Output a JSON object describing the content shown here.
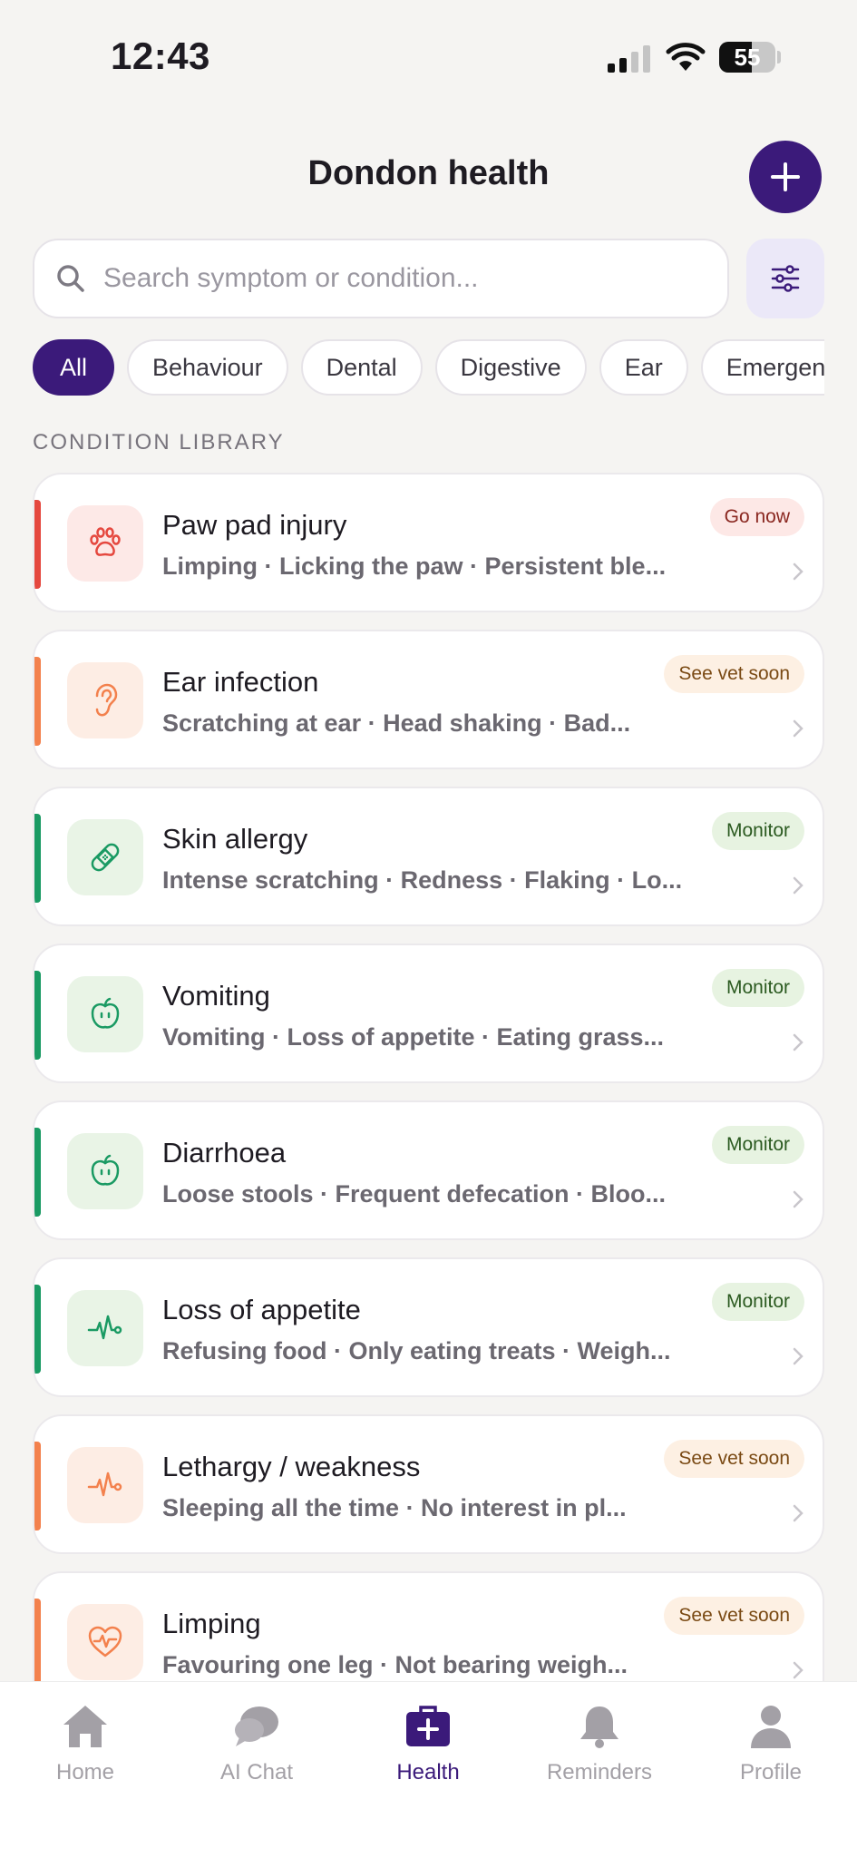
{
  "status_bar": {
    "time": "12:43",
    "battery": "55"
  },
  "header": {
    "title": "Dondon health"
  },
  "search": {
    "placeholder": "Search symptom or condition..."
  },
  "chips": [
    "All",
    "Behaviour",
    "Dental",
    "Digestive",
    "Ear",
    "Emergen"
  ],
  "section_label": "CONDITION LIBRARY",
  "conditions": [
    {
      "title": "Paw pad injury",
      "symptoms": "Limping · Licking the paw · Persistent ble...",
      "badge": "Go now",
      "urgency": "red",
      "icon": "paw-icon"
    },
    {
      "title": "Ear infection",
      "symptoms": "Scratching at ear · Head shaking · Bad...",
      "badge": "See vet soon",
      "urgency": "orange",
      "icon": "ear-icon"
    },
    {
      "title": "Skin allergy",
      "symptoms": "Intense scratching · Redness · Flaking · Lo...",
      "badge": "Monitor",
      "urgency": "green",
      "icon": "bandage-icon"
    },
    {
      "title": "Vomiting",
      "symptoms": "Vomiting · Loss of appetite · Eating grass...",
      "badge": "Monitor",
      "urgency": "green",
      "icon": "apple-icon"
    },
    {
      "title": "Diarrhoea",
      "symptoms": "Loose stools · Frequent defecation · Bloo...",
      "badge": "Monitor",
      "urgency": "green",
      "icon": "apple-icon"
    },
    {
      "title": "Loss of appetite",
      "symptoms": "Refusing food · Only eating treats · Weigh...",
      "badge": "Monitor",
      "urgency": "green",
      "icon": "pulse-icon"
    },
    {
      "title": "Lethargy / weakness",
      "symptoms": "Sleeping all the time · No interest in pl...",
      "badge": "See vet soon",
      "urgency": "orange",
      "icon": "pulse-icon"
    },
    {
      "title": "Limping",
      "symptoms": "Favouring one leg · Not bearing weigh...",
      "badge": "See vet soon",
      "urgency": "orange",
      "icon": "heart-pulse-icon"
    }
  ],
  "tabs": [
    {
      "label": "Home",
      "icon": "home-icon"
    },
    {
      "label": "AI Chat",
      "icon": "chat-bubble-icon"
    },
    {
      "label": "Health",
      "icon": "medical-kit-icon"
    },
    {
      "label": "Reminders",
      "icon": "bell-icon"
    },
    {
      "label": "Profile",
      "icon": "person-icon"
    }
  ],
  "colors": {
    "brand": "#3b1a7a",
    "urgent": "#e5483f",
    "soon": "#f3814d",
    "monitor": "#1a9a63"
  }
}
